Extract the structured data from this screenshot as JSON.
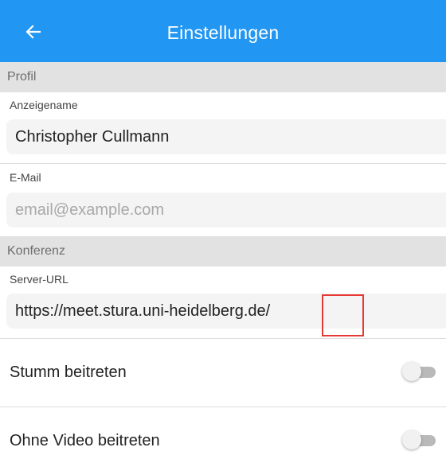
{
  "header": {
    "title": "Einstellungen",
    "back_icon": "arrow-left-icon",
    "background_color": "#2196f3"
  },
  "profile": {
    "section_title": "Profil",
    "display_name": {
      "label": "Anzeigename",
      "value": "Christopher Cullmann"
    },
    "email": {
      "label": "E-Mail",
      "value": "",
      "placeholder": "email@example.com"
    }
  },
  "conference": {
    "section_title": "Konferenz",
    "server_url": {
      "label": "Server-URL",
      "value": "https://meet.stura.uni-heidelberg.de/",
      "highlight_color": "#e53935"
    },
    "toggles": [
      {
        "label": "Stumm beitreten",
        "enabled": false
      },
      {
        "label": "Ohne Video beitreten",
        "enabled": false
      }
    ]
  }
}
